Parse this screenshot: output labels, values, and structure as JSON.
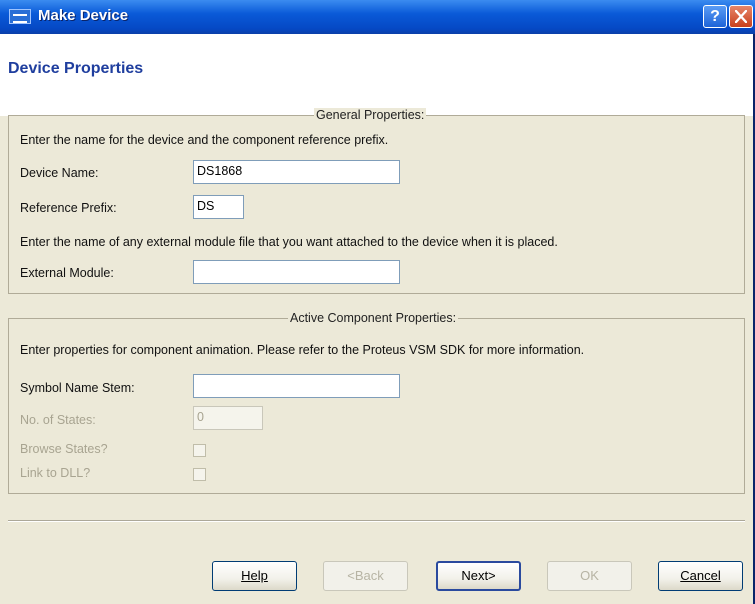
{
  "window": {
    "title": "Make Device",
    "help_glyph": "?"
  },
  "header": {
    "title": "Device Properties"
  },
  "general": {
    "legend": "General Properties:",
    "intro": "Enter the name for the device and the component reference prefix.",
    "device_name_label": "Device Name:",
    "device_name_value": "DS1868",
    "ref_prefix_label": "Reference Prefix:",
    "ref_prefix_value": "DS",
    "external_intro": "Enter the name of any external module file that you want attached to the device when it is placed.",
    "external_module_label": "External Module:",
    "external_module_value": ""
  },
  "active": {
    "legend": "Active Component Properties:",
    "intro": "Enter properties for component animation. Please refer to the Proteus VSM SDK for more information.",
    "symbol_stem_label": "Symbol Name Stem:",
    "symbol_stem_value": "",
    "states_label": "No. of States:",
    "states_value": "0",
    "browse_states_label": "Browse States?",
    "browse_states_checked": false,
    "link_dll_label": "Link to DLL?",
    "link_dll_checked": false
  },
  "buttons": {
    "help": "Help",
    "back": "<Back",
    "next": "Next>",
    "ok": "OK",
    "cancel": "Cancel"
  },
  "colors": {
    "titlebar": "#0548c4",
    "header_text": "#1f3e9e",
    "dialog_bg": "#ece9d8"
  }
}
